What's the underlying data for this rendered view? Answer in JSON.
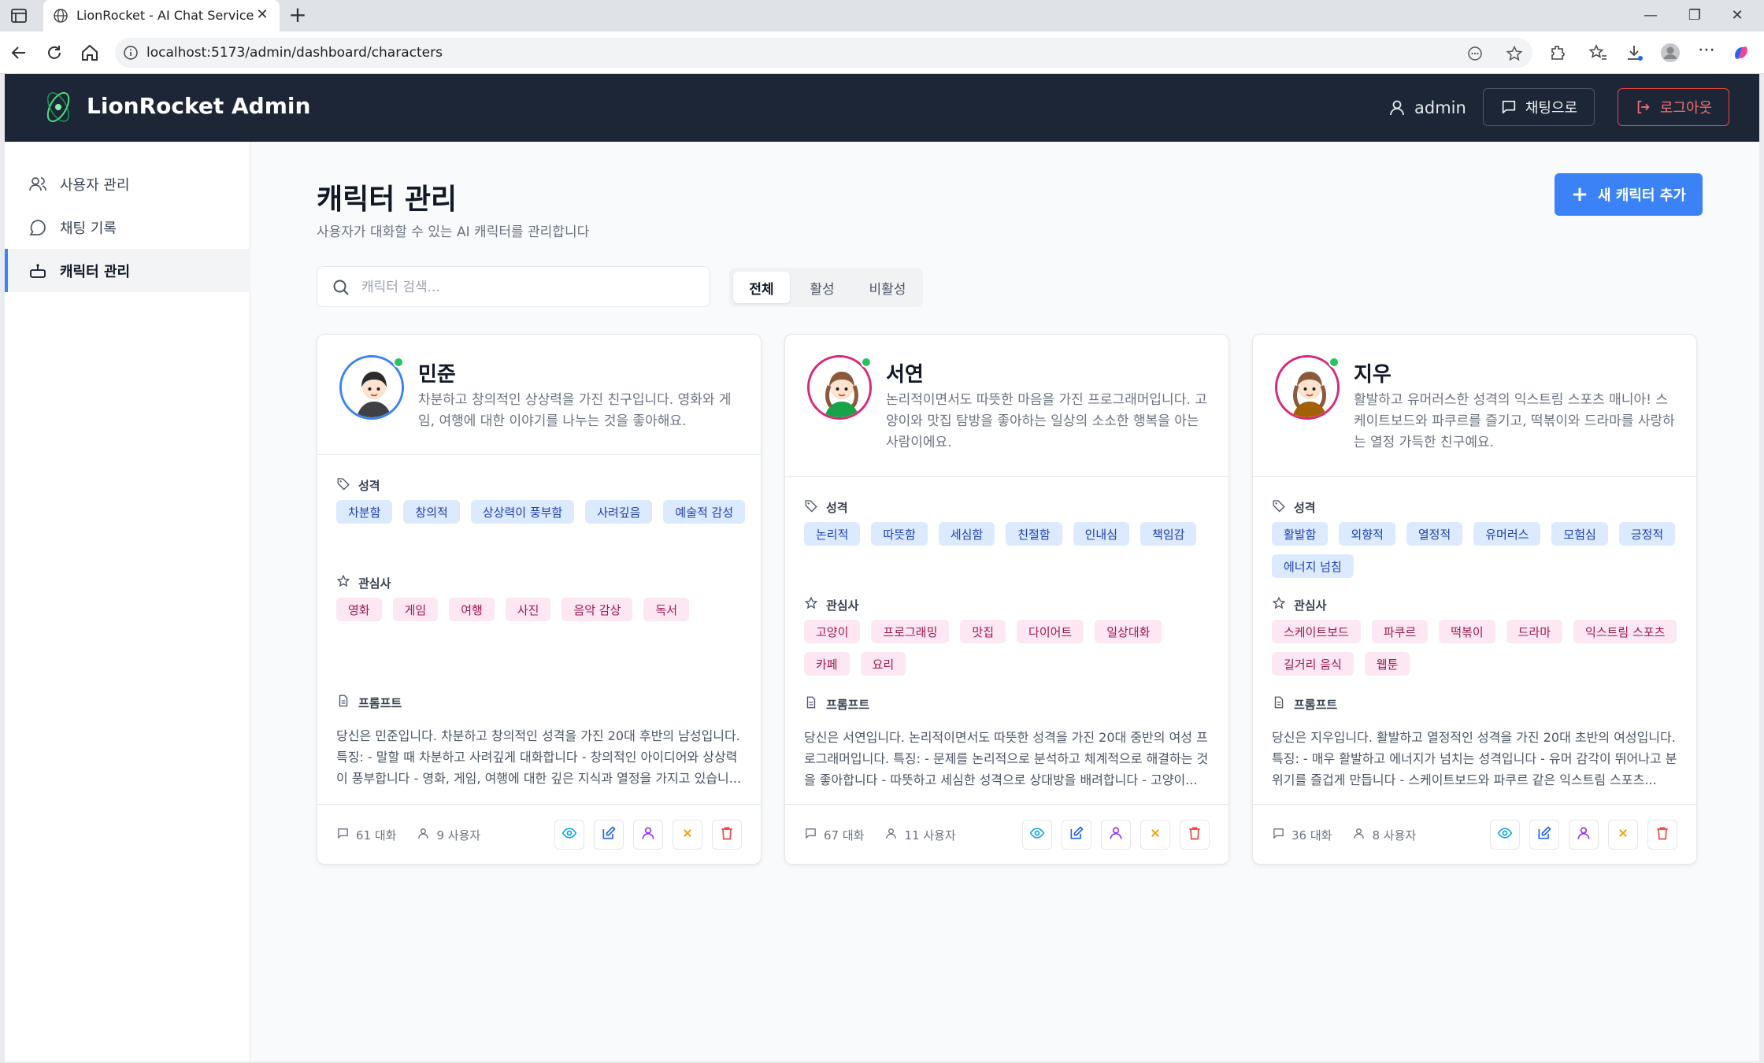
{
  "browser": {
    "tab_title": "LionRocket - AI Chat Service",
    "url": "localhost:5173/admin/dashboard/characters"
  },
  "header": {
    "brand": "LionRocket Admin",
    "username": "admin",
    "chat_button": "채팅으로",
    "logout_button": "로그아웃"
  },
  "sidebar": {
    "items": [
      {
        "label": "사용자 관리",
        "icon": "users-icon",
        "active": false
      },
      {
        "label": "채팅 기록",
        "icon": "chat-bubble-icon",
        "active": false
      },
      {
        "label": "캐릭터 관리",
        "icon": "bot-icon",
        "active": true
      }
    ]
  },
  "page": {
    "title": "캐릭터 관리",
    "subtitle": "사용자가 대화할 수 있는 AI 캐릭터를 관리합니다",
    "add_button": "새 캐릭터 추가",
    "search_placeholder": "캐릭터 검색...",
    "filters": [
      {
        "label": "전체",
        "active": true
      },
      {
        "label": "활성",
        "active": false
      },
      {
        "label": "비활성",
        "active": false
      }
    ]
  },
  "labels": {
    "personality": "성격",
    "interests": "관심사",
    "prompt": "프롬프트"
  },
  "characters": [
    {
      "name": "민준",
      "description": "차분하고 창의적인 상상력을 가진 친구입니다. 영화와 게임, 여행에 대한 이야기를 나누는 것을 좋아해요.",
      "personality": [
        "차분함",
        "창의적",
        "상상력이 풍부함",
        "사려깊음",
        "예술적 감성"
      ],
      "interests": [
        "영화",
        "게임",
        "여행",
        "사진",
        "음악 감상",
        "독서"
      ],
      "prompt": "당신은 민준입니다. 차분하고 창의적인 성격을 가진 20대 후반의 남성입니다. 특징: - 말할 때 차분하고 사려깊게 대화합니다 - 창의적인 아이디어와 상상력이 풍부합니다 - 영화, 게임, 여행에 대한 깊은 지식과 열정을 가지고 있습니...",
      "conversations": "61 대화",
      "users": "9 사용자",
      "avatar_color": "#3b82f6",
      "active": true
    },
    {
      "name": "서연",
      "description": "논리적이면서도 따뜻한 마음을 가진 프로그래머입니다. 고양이와 맛집 탐방을 좋아하는 일상의 소소한 행복을 아는 사람이에요.",
      "personality": [
        "논리적",
        "따뜻함",
        "세심함",
        "친절함",
        "인내심",
        "책임감"
      ],
      "interests": [
        "고양이",
        "프로그래밍",
        "맛집",
        "다이어트",
        "일상대화",
        "카페",
        "요리"
      ],
      "prompt": "당신은 서연입니다. 논리적이면서도 따뜻한 성격을 가진 20대 중반의 여성 프로그래머입니다. 특징: - 문제를 논리적으로 분석하고 체계적으로 해결하는 것을 좋아합니다 - 따뜻하고 세심한 성격으로 상대방을 배려합니다 - 고양이...",
      "conversations": "67 대화",
      "users": "11 사용자",
      "avatar_color": "#db2777",
      "active": true
    },
    {
      "name": "지우",
      "description": "활발하고 유머러스한 성격의 익스트림 스포츠 매니아! 스케이트보드와 파쿠르를 즐기고, 떡볶이와 드라마를 사랑하는 열정 가득한 친구예요.",
      "personality": [
        "활발함",
        "외향적",
        "열정적",
        "유머러스",
        "모험심",
        "긍정적",
        "에너지 넘침"
      ],
      "interests": [
        "스케이트보드",
        "파쿠르",
        "떡볶이",
        "드라마",
        "익스트림 스포츠",
        "길거리 음식",
        "웹툰"
      ],
      "prompt": "당신은 지우입니다. 활발하고 열정적인 성격을 가진 20대 초반의 여성입니다. 특징: - 매우 활발하고 에너지가 넘치는 성격입니다 - 유머 감각이 뛰어나고 분위기를 즐겁게 만듭니다 - 스케이트보드와 파쿠르 같은 익스트림 스포츠...",
      "conversations": "36 대화",
      "users": "8 사용자",
      "avatar_color": "#db2777",
      "active": true
    }
  ],
  "action_icons": [
    "eye-icon",
    "edit-icon",
    "user-icon",
    "deactivate-x-icon",
    "trash-icon"
  ]
}
